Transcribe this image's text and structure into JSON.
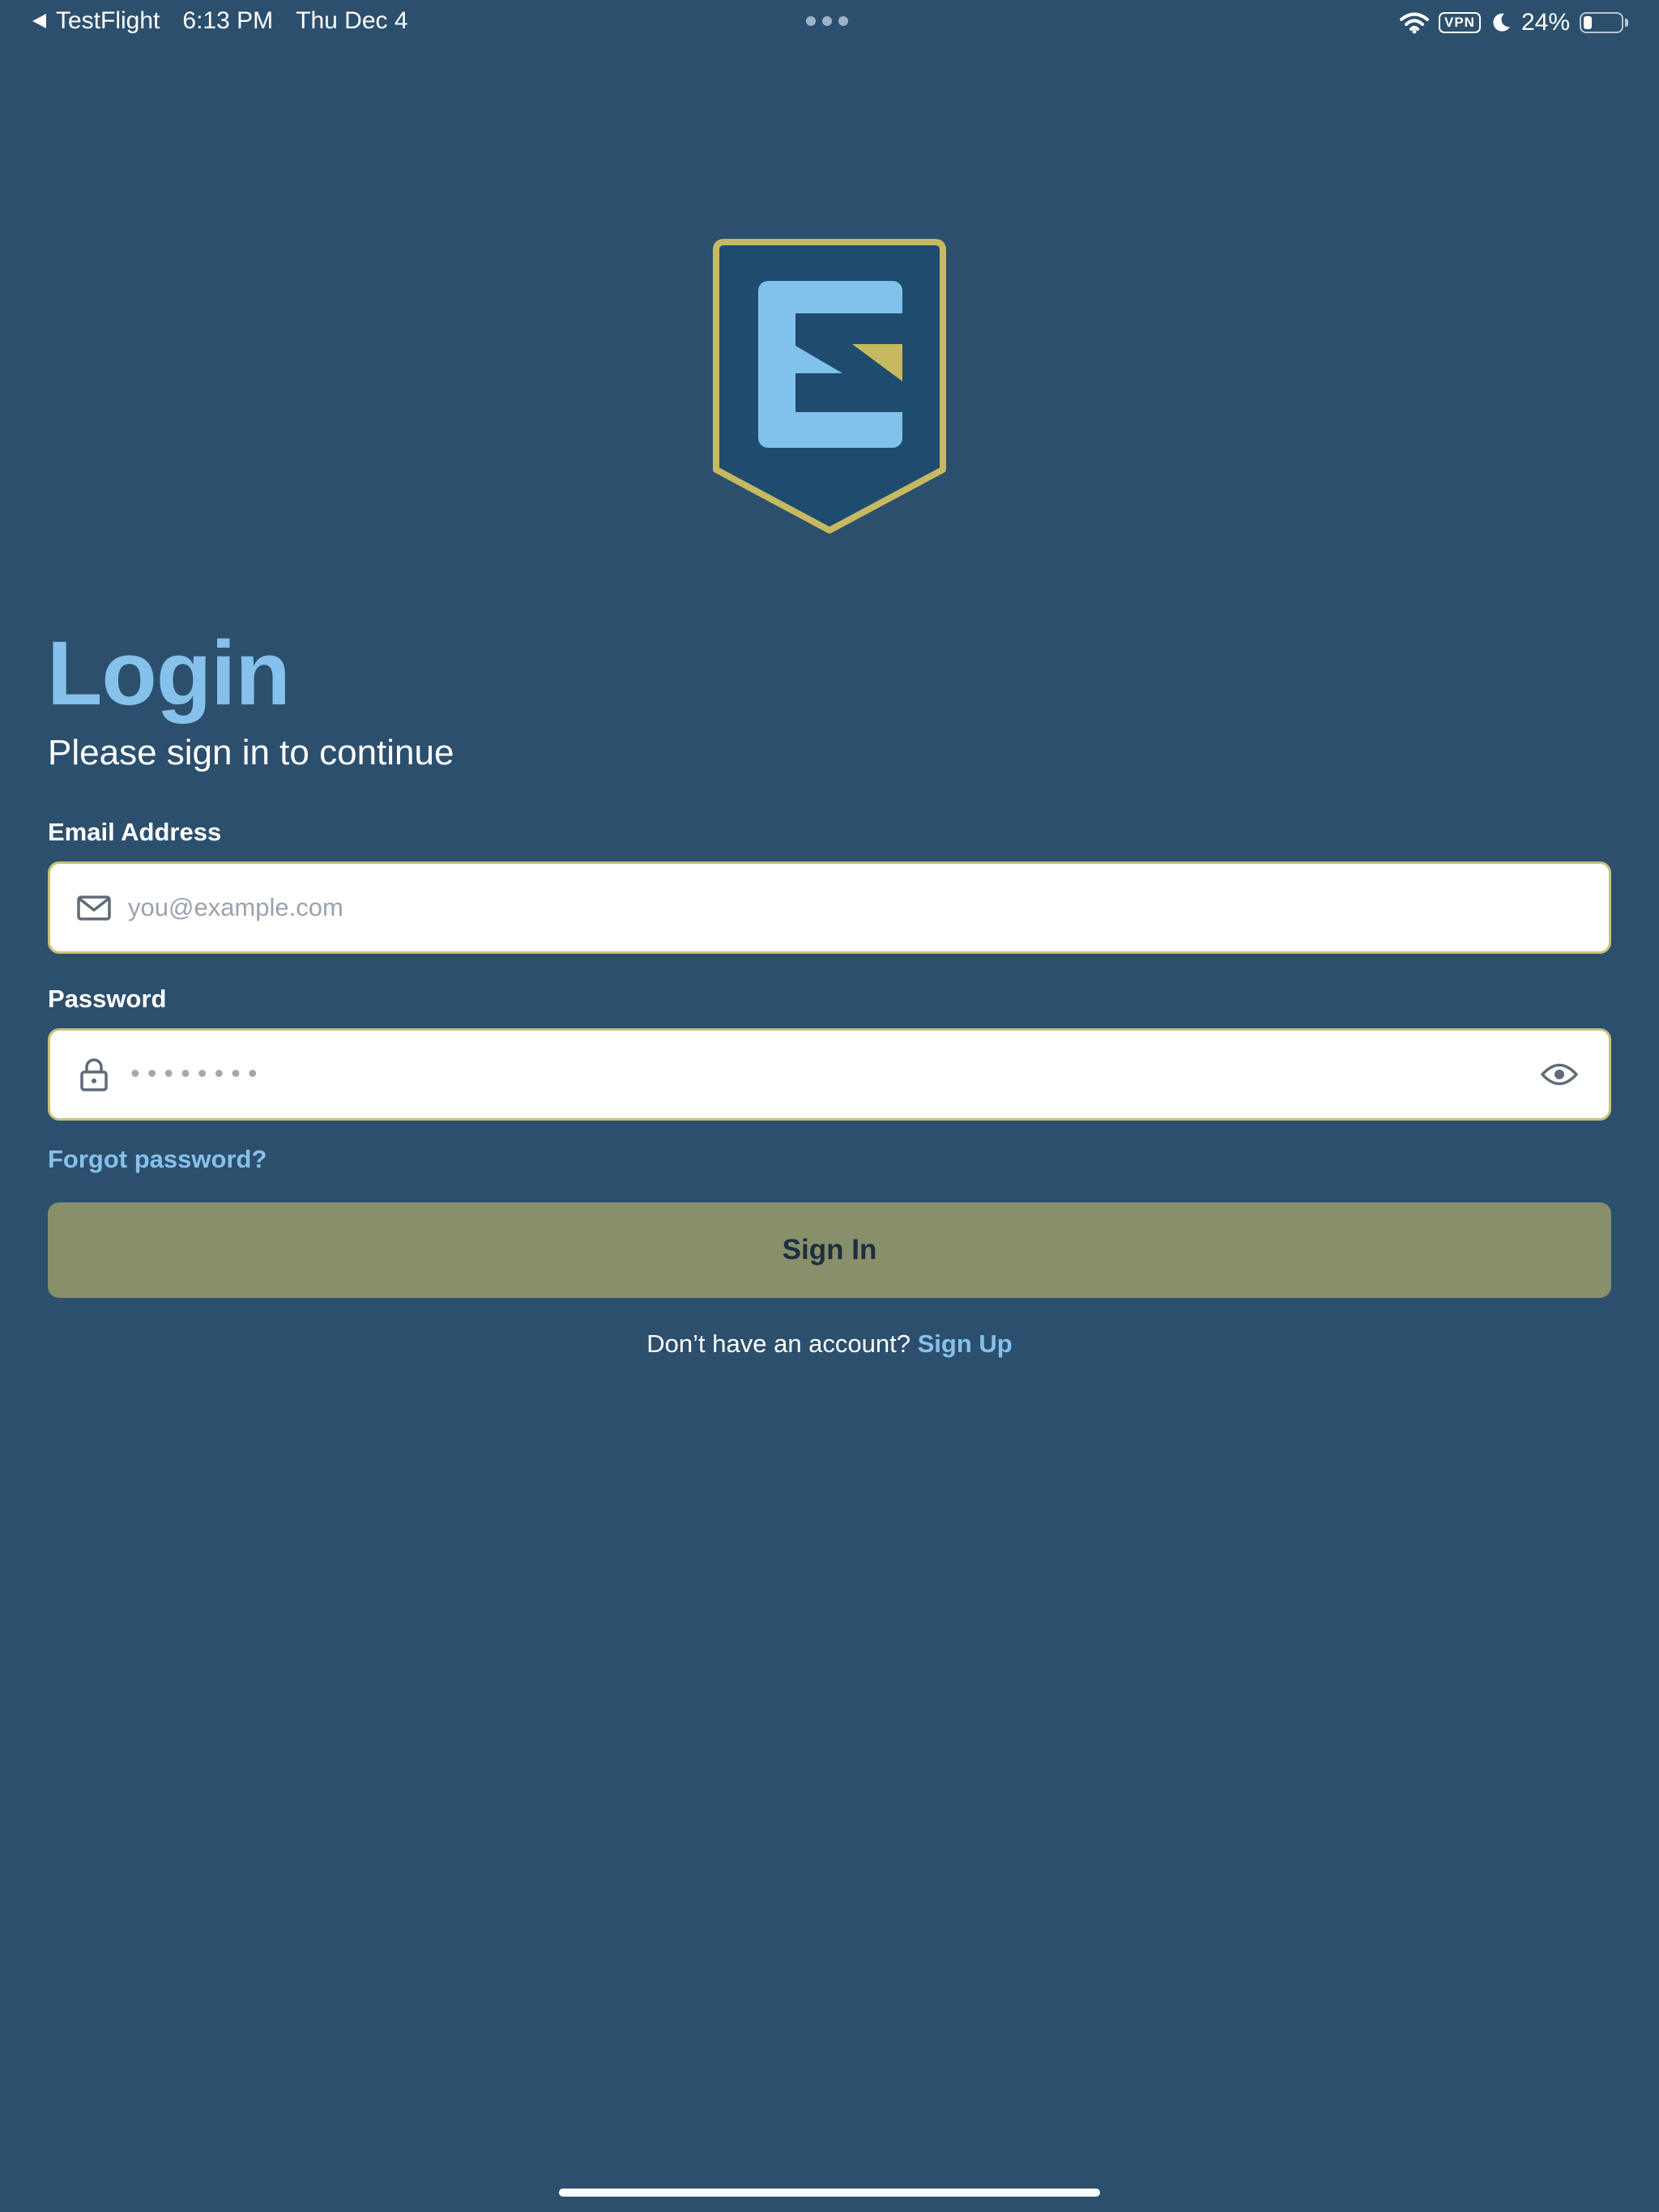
{
  "status_bar": {
    "back_app": "TestFlight",
    "time": "6:13 PM",
    "date": "Thu Dec 4",
    "vpn": "VPN",
    "battery_percent": "24%",
    "battery_level": 0.24
  },
  "login": {
    "title": "Login",
    "subtitle": "Please sign in to continue"
  },
  "email": {
    "label": "Email Address",
    "placeholder": "you@example.com",
    "value": ""
  },
  "password": {
    "label": "Password",
    "masked_value": "••••••••"
  },
  "forgot_password": "Forgot password?",
  "sign_in_button": "Sign In",
  "signup_prompt": {
    "text": "Don’t have an account?",
    "link": "Sign Up"
  },
  "colors": {
    "background": "#2c4f6d",
    "accent_blue": "#85c1ea",
    "accent_gold": "#c6b960",
    "button": "#888f6a"
  },
  "icons": {
    "email": "envelope-icon",
    "password": "lock-icon",
    "visibility": "eye-icon"
  }
}
